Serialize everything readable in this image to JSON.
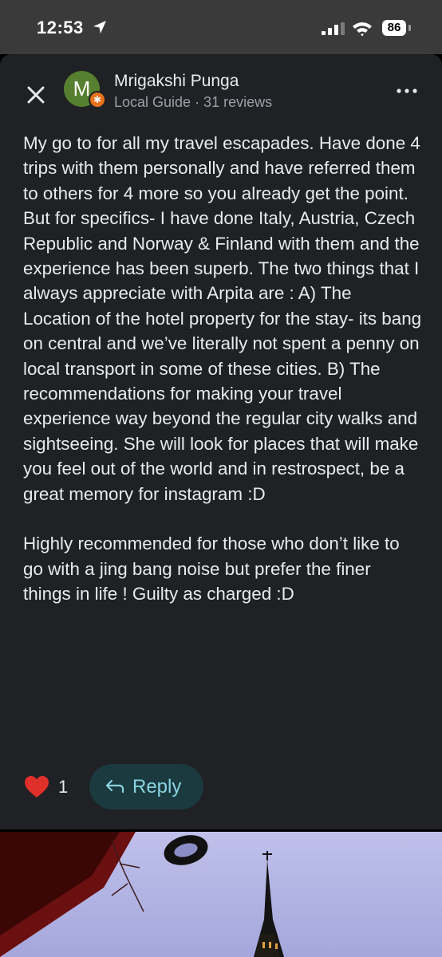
{
  "status_bar": {
    "time": "12:53",
    "battery": "86",
    "icons": [
      "location-arrow-icon",
      "cellular-signal-icon",
      "wifi-icon",
      "battery-icon"
    ]
  },
  "review": {
    "author": {
      "initial": "M",
      "name": "Mrigakshi Punga",
      "meta": "Local Guide · 31 reviews",
      "avatar_color": "#56802f",
      "badge_color": "#e8711c"
    },
    "paragraphs": [
      "My go to for all my travel escapades. Have done 4 trips with them personally and have referred them to others for 4 more so you already get the point. But for specifics- I have done Italy, Austria, Czech Republic and Norway & Finland with them and the experience has been superb. The two things that I always appreciate with Arpita are : A) The Location of the hotel property for the stay- its bang on central and we’ve literally not spent a penny on local transport in some of these cities. B) The recommendations for making your travel experience way beyond the regular city walks and sightseeing. She will look for places that will make you feel out of the world and in restrospect, be a great memory for instagram :D",
      "Highly recommended for those who don’t like to go with a jing bang noise but prefer the finer things in life ! Guilty as charged :D"
    ],
    "likes": "1",
    "reply_label": "Reply",
    "icons": [
      "close-icon",
      "more-options-icon",
      "heart-icon",
      "reply-icon"
    ]
  },
  "colors": {
    "sheet_background": "#1f2125",
    "reply_button_bg": "#1a3a3f",
    "reply_button_text": "#8ad3df",
    "heart": "#e0302a"
  }
}
